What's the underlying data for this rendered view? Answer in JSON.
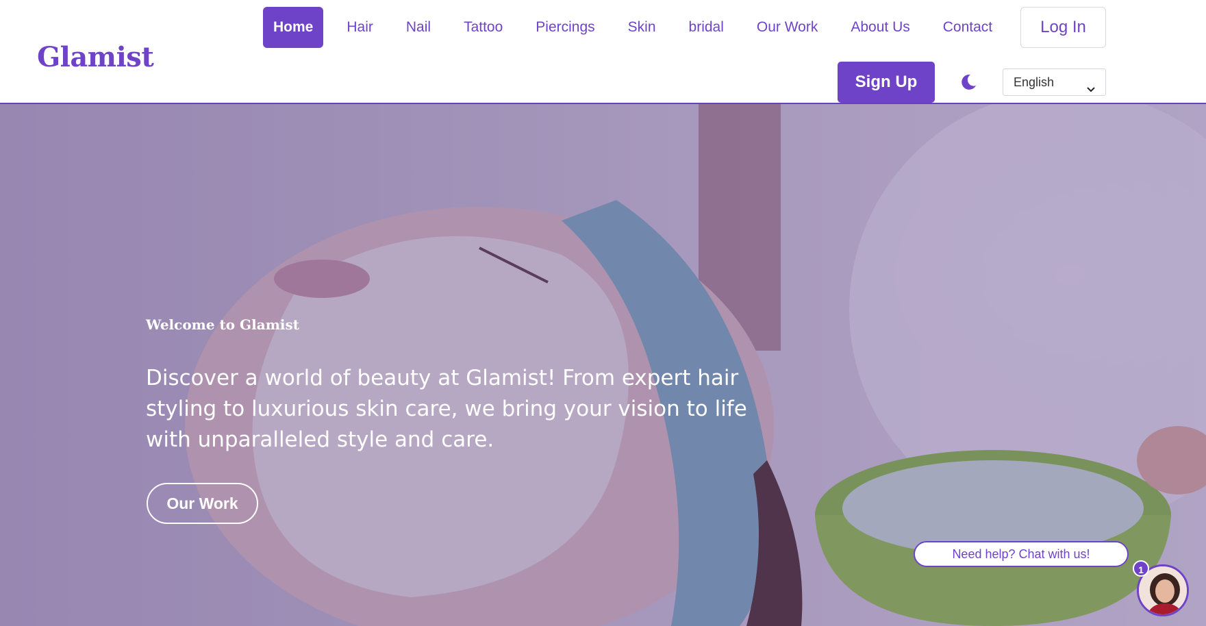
{
  "brand": {
    "logo": "Glamist",
    "accent_color": "#6f43c7"
  },
  "nav": {
    "items": [
      {
        "label": "Home",
        "active": true
      },
      {
        "label": "Hair"
      },
      {
        "label": "Nail"
      },
      {
        "label": "Tattoo"
      },
      {
        "label": "Piercings"
      },
      {
        "label": "Skin"
      },
      {
        "label": "bridal"
      },
      {
        "label": "Our Work"
      },
      {
        "label": "About Us"
      },
      {
        "label": "Contact"
      }
    ]
  },
  "auth": {
    "login_label": "Log In",
    "signup_label": "Sign Up"
  },
  "theme_toggle": {
    "icon": "moon-icon"
  },
  "language": {
    "selected": "English",
    "icon": "chevron-down-icon"
  },
  "hero": {
    "welcome": "Welcome to Glamist",
    "description": "Discover a world of beauty at Glamist! From expert hair styling to luxurious skin care, we bring your vision to life with unparalleled style and care.",
    "cta_label": "Our Work"
  },
  "chat": {
    "prompt": "Need help? Chat with us!",
    "badge_count": "1"
  }
}
